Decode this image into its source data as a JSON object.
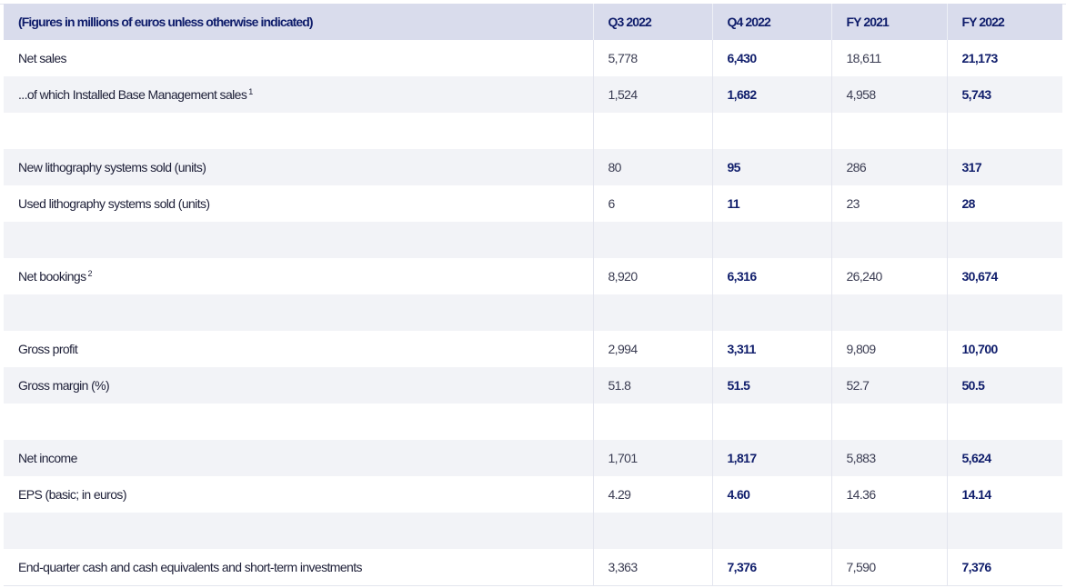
{
  "table": {
    "headers": [
      "(Figures in millions of euros unless otherwise indicated)",
      "Q3 2022",
      "Q4 2022",
      "FY 2021",
      "FY 2022"
    ],
    "rows": [
      {
        "label": "Net sales",
        "footnote": "",
        "values": [
          "5,778",
          "6,430",
          "18,611",
          "21,173"
        ]
      },
      {
        "label": "...of which Installed Base Management sales",
        "footnote": "1",
        "values": [
          "1,524",
          "1,682",
          "4,958",
          "5,743"
        ]
      },
      {
        "label": "",
        "footnote": "",
        "values": [
          "",
          "",
          "",
          ""
        ]
      },
      {
        "label": "New lithography systems sold (units)",
        "footnote": "",
        "values": [
          "80",
          "95",
          "286",
          "317"
        ]
      },
      {
        "label": "Used lithography systems sold (units)",
        "footnote": "",
        "values": [
          "6",
          "11",
          "23",
          "28"
        ]
      },
      {
        "label": "",
        "footnote": "",
        "values": [
          "",
          "",
          "",
          ""
        ]
      },
      {
        "label": "Net bookings",
        "footnote": "2",
        "values": [
          "8,920",
          "6,316",
          "26,240",
          "30,674"
        ]
      },
      {
        "label": "",
        "footnote": "",
        "values": [
          "",
          "",
          "",
          ""
        ]
      },
      {
        "label": "Gross profit",
        "footnote": "",
        "values": [
          "2,994",
          "3,311",
          "9,809",
          "10,700"
        ]
      },
      {
        "label": "Gross margin (%)",
        "footnote": "",
        "values": [
          "51.8",
          "51.5",
          "52.7",
          "50.5"
        ]
      },
      {
        "label": "",
        "footnote": "",
        "values": [
          "",
          "",
          "",
          ""
        ]
      },
      {
        "label": "Net income",
        "footnote": "",
        "values": [
          "1,701",
          "1,817",
          "5,883",
          "5,624"
        ]
      },
      {
        "label": "EPS (basic; in euros)",
        "footnote": "",
        "values": [
          "4.29",
          "4.60",
          "14.36",
          "14.14"
        ]
      },
      {
        "label": "",
        "footnote": "",
        "values": [
          "",
          "",
          "",
          ""
        ]
      },
      {
        "label": "End-quarter cash and cash equivalents and short-term investments",
        "footnote": "",
        "values": [
          "3,363",
          "7,376",
          "7,590",
          "7,376"
        ]
      }
    ]
  },
  "colors": {
    "header_bg": "#d9dcec",
    "header_text": "#0f1d6b",
    "stripe_bg": "#f2f3f7",
    "emphasis_text": "#0f1d6b"
  }
}
